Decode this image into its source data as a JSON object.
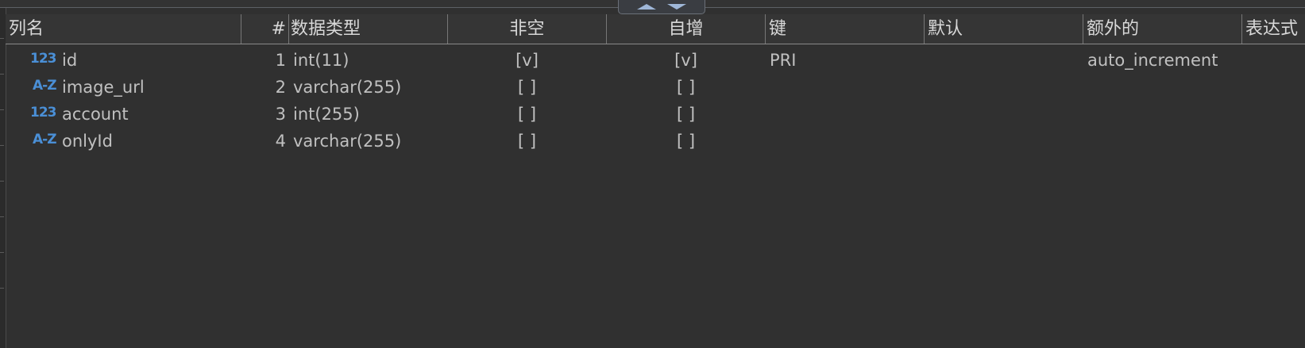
{
  "toolbar": {
    "collapse_up_icon": "chevron-up-icon",
    "collapse_down_icon": "chevron-down-icon"
  },
  "columns_header": {
    "name": "列名",
    "ordinal": "#",
    "data_type": "数据类型",
    "not_null": "非空",
    "auto_increment": "自增",
    "key": "键",
    "default": "默认",
    "extra": "额外的",
    "expression": "表达式"
  },
  "rows": [
    {
      "type_icon": "123",
      "type_icon_name": "numeric-type-icon",
      "name": "id",
      "ordinal": "1",
      "data_type": "int(11)",
      "not_null": "[v]",
      "auto_increment": "[v]",
      "key": "PRI",
      "default": "",
      "extra": "auto_increment"
    },
    {
      "type_icon": "A-Z",
      "type_icon_name": "string-type-icon",
      "name": "image_url",
      "ordinal": "2",
      "data_type": "varchar(255)",
      "not_null": "[ ]",
      "auto_increment": "[ ]",
      "key": "",
      "default": "",
      "extra": ""
    },
    {
      "type_icon": "123",
      "type_icon_name": "numeric-type-icon",
      "name": "account",
      "ordinal": "3",
      "data_type": "int(255)",
      "not_null": "[ ]",
      "auto_increment": "[ ]",
      "key": "",
      "default": "",
      "extra": ""
    },
    {
      "type_icon": "A-Z",
      "type_icon_name": "string-type-icon",
      "name": "onlyId",
      "ordinal": "4",
      "data_type": "varchar(255)",
      "not_null": "[ ]",
      "auto_increment": "[ ]",
      "key": "",
      "default": "",
      "extra": ""
    }
  ],
  "colors": {
    "background": "#303030",
    "header_background": "#353535",
    "type_icon": "#4a8fd6",
    "text": "#c0c0c0"
  }
}
